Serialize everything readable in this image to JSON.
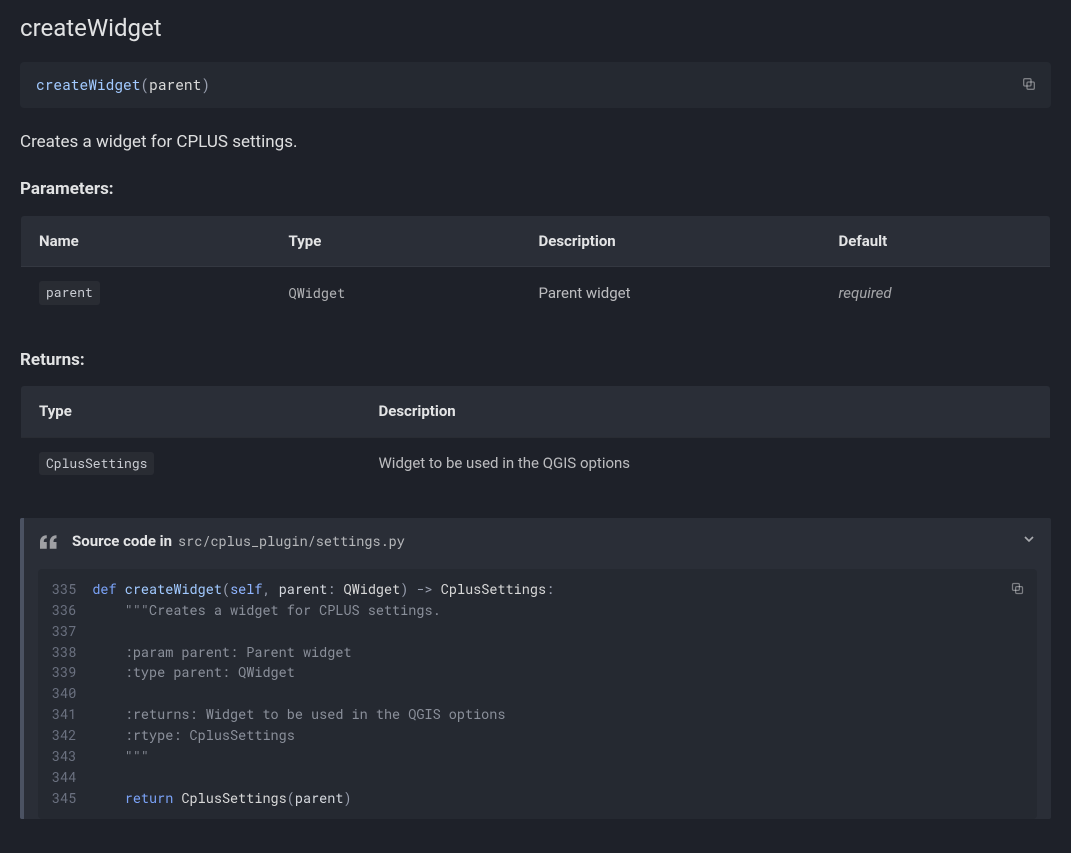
{
  "title": "createWidget",
  "signature": {
    "func": "createWidget",
    "open": "(",
    "arg": "parent",
    "close": ")"
  },
  "description": "Creates a widget for CPLUS settings.",
  "parameters": {
    "heading": "Parameters:",
    "headers": {
      "name": "Name",
      "type": "Type",
      "description": "Description",
      "default": "Default"
    },
    "rows": [
      {
        "name": "parent",
        "type": "QWidget",
        "description": "Parent widget",
        "default": "required"
      }
    ]
  },
  "returns": {
    "heading": "Returns:",
    "headers": {
      "type": "Type",
      "description": "Description"
    },
    "rows": [
      {
        "type": "CplusSettings",
        "description": "Widget to be used in the QGIS options"
      }
    ]
  },
  "source": {
    "label": "Source code in",
    "path": "src/cplus_plugin/settings.py",
    "line_start": 335,
    "line_end": 345,
    "code": {
      "def": "def",
      "func": "createWidget",
      "self": "self",
      "arg": "parent",
      "argtype": "QWidget",
      "rettype": "CplusSettings",
      "doc1": "\"\"\"Creates a widget for CPLUS settings.",
      "doc_param": ":param parent: Parent widget",
      "doc_type": ":type parent: QWidget",
      "doc_returns": ":returns: Widget to be used in the QGIS options",
      "doc_rtype": ":rtype: CplusSettings",
      "doc_close": "\"\"\"",
      "return_kw": "return",
      "return_expr_cls": "CplusSettings",
      "return_expr_arg": "parent"
    }
  }
}
